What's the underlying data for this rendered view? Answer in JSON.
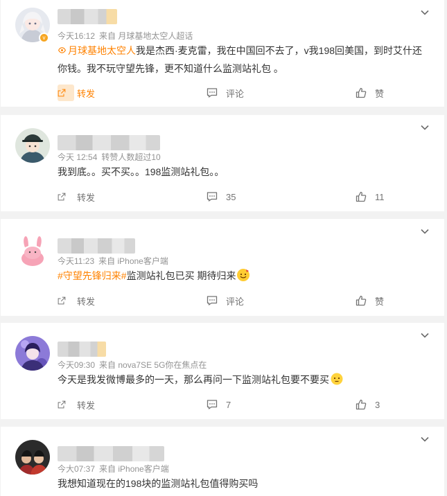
{
  "posts": [
    {
      "time": "今天16:12",
      "source": "来自 月球基地太空人超话",
      "topic": "月球基地太空人",
      "text": "我是杰西·麦克雷，我在中国回不去了，v我198回美国，到时艾什还你钱。我不玩守望先锋，更不知道什么监测站礼包 。",
      "forward_label": "转发",
      "comment_label": "评论",
      "like_label": "赞"
    },
    {
      "time": "今天 12:54",
      "source": "转赞人数超过10",
      "text": "我到底。。买不买。。198监测站礼包。。",
      "forward_label": "转发",
      "comment_label": "35",
      "like_label": "11"
    },
    {
      "time": "今天11:23",
      "source": "来自 iPhone客户端",
      "topic": "#守望先锋归来#",
      "text": "监测站礼包已买 期待归来",
      "forward_label": "转发",
      "comment_label": "评论",
      "like_label": "赞"
    },
    {
      "time": "今天09:30",
      "source": "来自 nova7SE 5G你在焦点在",
      "text": "今天是我发微博最多的一天，那么再问一下监测站礼包要不要买",
      "forward_label": "转发",
      "comment_label": "7",
      "like_label": "3"
    },
    {
      "time": "今大07:37",
      "source": "来自 iPhone客户端",
      "text": "我想知道现在的198块的监测站礼包值得购买吗"
    }
  ],
  "colors": {
    "accent": "#ff8200",
    "meta": "#939393",
    "background": "#f2f2f2"
  }
}
